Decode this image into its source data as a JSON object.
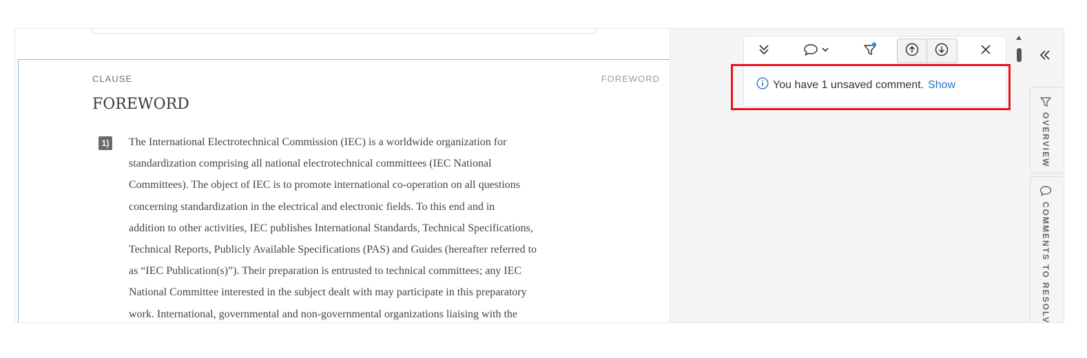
{
  "document": {
    "clause_label": "CLAUSE",
    "clause_right_label": "FOREWORD",
    "clause_title": "FOREWORD",
    "paragraph_number": "1)",
    "paragraph_lines": [
      "The International Electrotechnical Commission (IEC) is a worldwide organization for",
      "standardization comprising all national electrotechnical committees (IEC National",
      "Committees). The object of IEC is to promote international co-operation on all questions",
      "concerning standardization in the electrical and electronic fields. To this end and in",
      "addition to other activities, IEC publishes International Standards, Technical Specifications,",
      "Technical Reports, Publicly Available Specifications (PAS) and Guides (hereafter referred to",
      "as “IEC Publication(s)”). Their preparation is entrusted to technical committees; any IEC",
      "National Committee interested in the subject dealt with may participate in this preparatory",
      "work. International, governmental and non-governmental organizations liaising with the"
    ]
  },
  "toolbar": {
    "icons": [
      "double-chevron-down-icon",
      "comment-icon",
      "chevron-down-icon",
      "filter-icon",
      "arrow-up-circle-icon",
      "arrow-down-circle-icon",
      "close-icon"
    ]
  },
  "notice": {
    "text": "You have 1 unsaved comment.",
    "link": "Show",
    "icon": "info-icon"
  },
  "side_rail": {
    "tab_overview": "OVERVIEW",
    "tab_comments": "COMMENTS TO RESOLVE"
  },
  "colors": {
    "highlight": "#e8121f",
    "link": "#2a72c5",
    "clause_border": "#7fb6ee",
    "filter_dot": "#2a86e0"
  }
}
